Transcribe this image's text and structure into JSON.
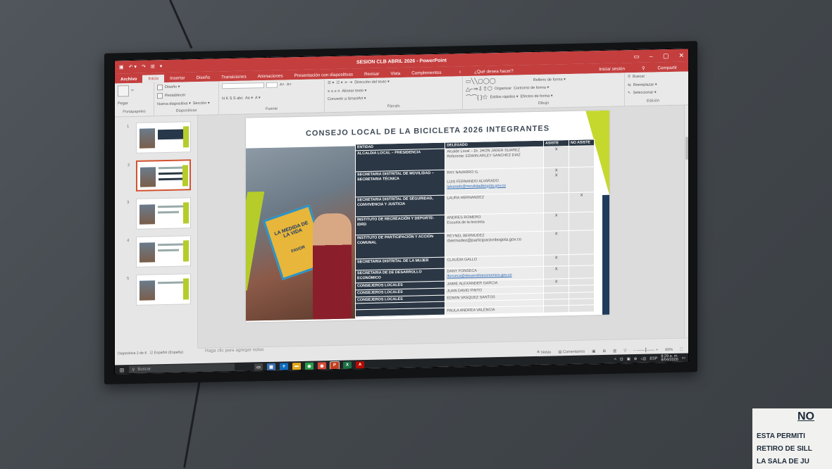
{
  "window": {
    "title": "SESION CLB ABRIL 2026 - PowerPoint",
    "controls": [
      "▭",
      "–",
      "▢",
      "✕"
    ]
  },
  "tabs": {
    "file": "Archivo",
    "items": [
      "Inicio",
      "Insertar",
      "Diseño",
      "Transiciones",
      "Animaciones",
      "Presentación con diapositivas",
      "Revisar",
      "Vista",
      "Complementos"
    ],
    "active": "Inicio",
    "tell_me": "¿Qué desea hacer?",
    "signin": "Iniciar sesión",
    "share": "Compartir"
  },
  "ribbon": {
    "groups": [
      {
        "label": "Portapapeles",
        "items": [
          "Pegar"
        ]
      },
      {
        "label": "Diapositivas",
        "items": [
          "Diseño ▾",
          "Restablecer",
          "Nueva diapositiva ▾",
          "Sección ▾"
        ]
      },
      {
        "label": "Fuente",
        "items": [
          "N K S S abc",
          "Aa ▾"
        ]
      },
      {
        "label": "Párrafo",
        "items": [
          "Dirección del texto ▾",
          "Alinear texto ▾",
          "Convertir a SmartArt ▾"
        ]
      },
      {
        "label": "Dibujo",
        "items": [
          "Organizar",
          "Estilos rápidos ▾",
          "Relleno de forma ▾",
          "Contorno de forma ▾",
          "Efectos de forma ▾"
        ]
      },
      {
        "label": "Edición",
        "items": [
          "Buscar",
          "Reemplazar ▾",
          "Seleccionar ▾"
        ]
      }
    ]
  },
  "slide": {
    "title": "CONSEJO LOCAL DE LA BICICLETA 2026 INTEGRANTES",
    "photo_text": [
      "LA MEDIDA DE LA VIDA",
      "FAVOR"
    ],
    "headers": [
      "ENTIDAD",
      "DELEGADO",
      "ASISTE",
      "NO ASISTE"
    ],
    "rows": [
      {
        "entity": "ALCALDIA LOCAL – PRESIDENCIA",
        "delegate": [
          "Alcalde Local – Dr. JHON JADER SUAREZ",
          "Referente: EDWIN ARLEY SANCHEZ DIAZ"
        ],
        "asiste": "X",
        "no_asiste": ""
      },
      {
        "entity": "SECRETARIA DISTRITAL DE MOVILIDAD – SECRETARIA TÉCNICA",
        "delegate": [
          "RAY NAVARRO G.",
          "LUIS FERNANDO ALVARADO"
        ],
        "link": "lalvarado@movilidadbogota.gov.co",
        "asiste": "X",
        "asiste2": "X",
        "no_asiste": ""
      },
      {
        "entity": "SECRETARIA DISTRITAL DE SEGURIDAD, CONVIVENCIA Y JUSTICIA",
        "delegate": [
          "LAURA HERNANDEZ"
        ],
        "asiste": "",
        "no_asiste": "X"
      },
      {
        "entity": "INSTITUTO DE RECREACIÓN Y DEPORTE- IDRD",
        "delegate": [
          "ANDRES ROMERO",
          "Escuela de la bicicleta"
        ],
        "asiste": "X",
        "no_asiste": ""
      },
      {
        "entity": "INSTITUTO DE PARTICIPACIÓN Y ACCIÓN COMUNAL",
        "delegate": [
          "REYNEL BERMUDEZ",
          "rbermudez@participacionbogota.gov.co"
        ],
        "asiste": "X",
        "no_asiste": ""
      },
      {
        "entity": "SECRETARIA DISTRITAL DE LA MUJER",
        "delegate": [
          "CLAUDIA GALLO"
        ],
        "asiste": "X",
        "no_asiste": ""
      },
      {
        "entity": "SECRETARIA DE DE DESARROLLO ECONÓMICO",
        "delegate": [
          "DANY FONSECA"
        ],
        "link": "lfonseca@desarrolloeconomico.gov.co",
        "asiste": "X",
        "no_asiste": ""
      },
      {
        "entity": "CONSEJEROS LOCALES",
        "delegate": [
          "JAIME ALEXANDER GARCIA"
        ],
        "asiste": "X",
        "no_asiste": ""
      },
      {
        "entity": "CONSEJEROS LOCALES",
        "delegate": [
          "JUAN DAVID PINTO"
        ],
        "asiste": "",
        "no_asiste": ""
      },
      {
        "entity": "CONSEJEROS LOCALES",
        "delegate": [
          "EDWIN VASQUEZ SANTOS"
        ],
        "asiste": "",
        "no_asiste": ""
      },
      {
        "entity": "",
        "delegate": [
          ""
        ],
        "asiste": "",
        "no_asiste": ""
      },
      {
        "entity": "",
        "delegate": [
          "PAULA ANDREA VALENCIA"
        ],
        "asiste": "",
        "no_asiste": ""
      }
    ]
  },
  "thumbnails": [
    "1",
    "2",
    "3",
    "4",
    "5"
  ],
  "notes_placeholder": "Haga clic para agregar notas",
  "status": {
    "slide_info": "Diapositiva 2 de 6",
    "language": "Español (España)",
    "notes": "Notas",
    "comments": "Comentarios",
    "zoom": "69%"
  },
  "taskbar": {
    "search": "Buscar",
    "lang": "ESP",
    "time": "8:29 a. m.",
    "date": "8/04/2026"
  },
  "wall_sign": {
    "lines": [
      "NO",
      "ESTA PERMITI",
      "RETIRO DE SILL",
      "LA SALA DE JU"
    ]
  }
}
